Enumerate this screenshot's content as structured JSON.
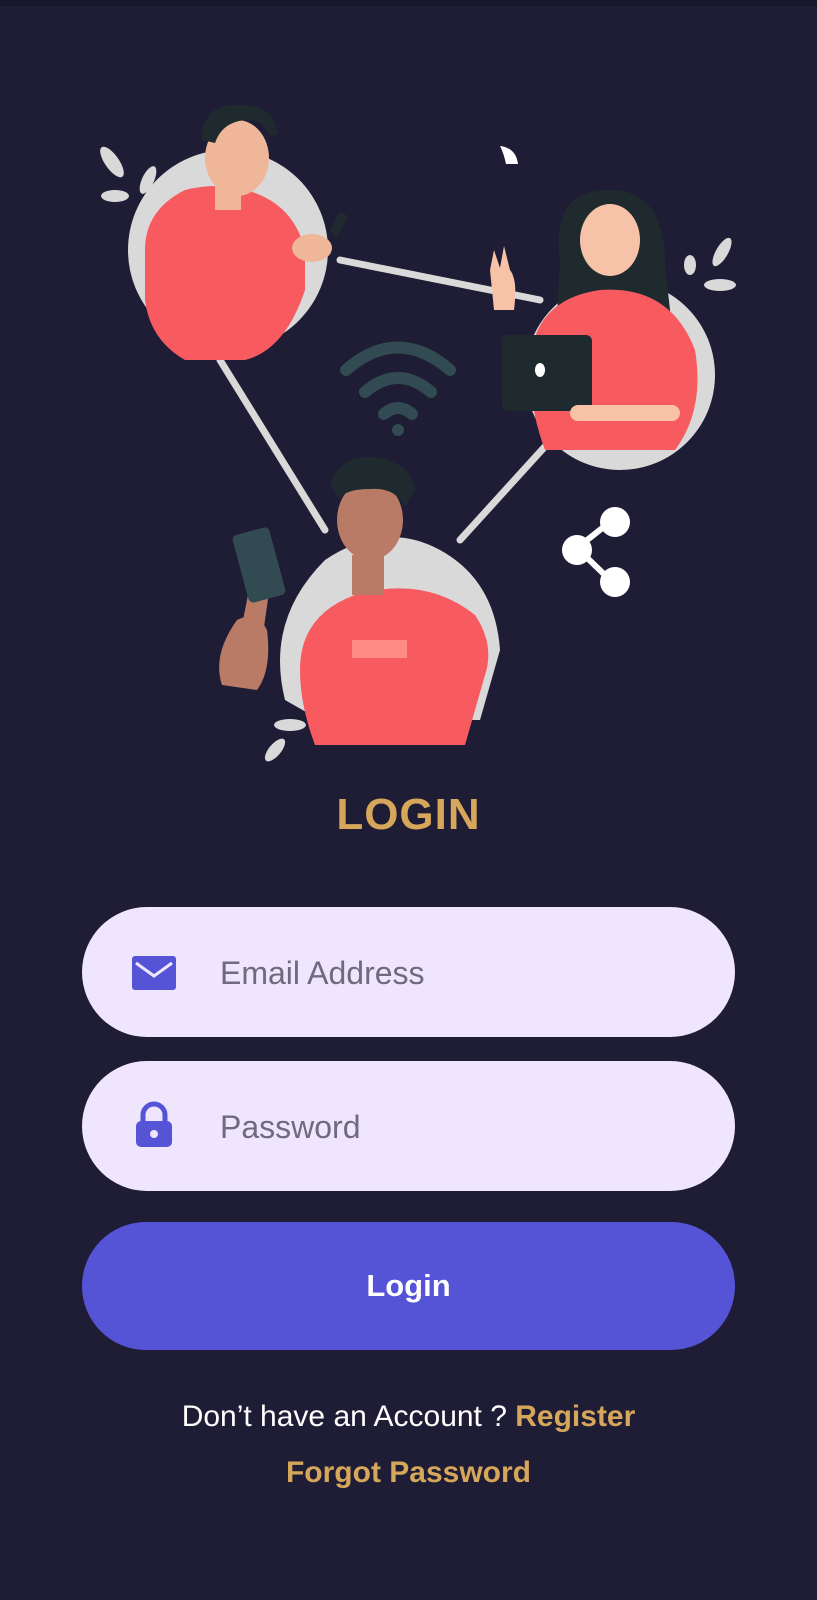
{
  "app": {
    "title": "LOGIN"
  },
  "form": {
    "email": {
      "placeholder": "Email Address",
      "value": "",
      "icon": "envelope-icon"
    },
    "password": {
      "placeholder": "Password",
      "value": "",
      "icon": "lock-icon"
    },
    "submit_label": "Login"
  },
  "footer": {
    "register_prompt": "Don’t have an Account ? ",
    "register_link": "Register",
    "forgot_link": "Forgot Password"
  },
  "illustration": {
    "icons": [
      "wifi-icon",
      "share-icon"
    ]
  },
  "colors": {
    "background": "#1e1d35",
    "accent": "#d6a65a",
    "primary": "#5654d6",
    "field_bg": "#efe6fd",
    "icon": "#5654d6",
    "shirt": "#f75a5f"
  }
}
